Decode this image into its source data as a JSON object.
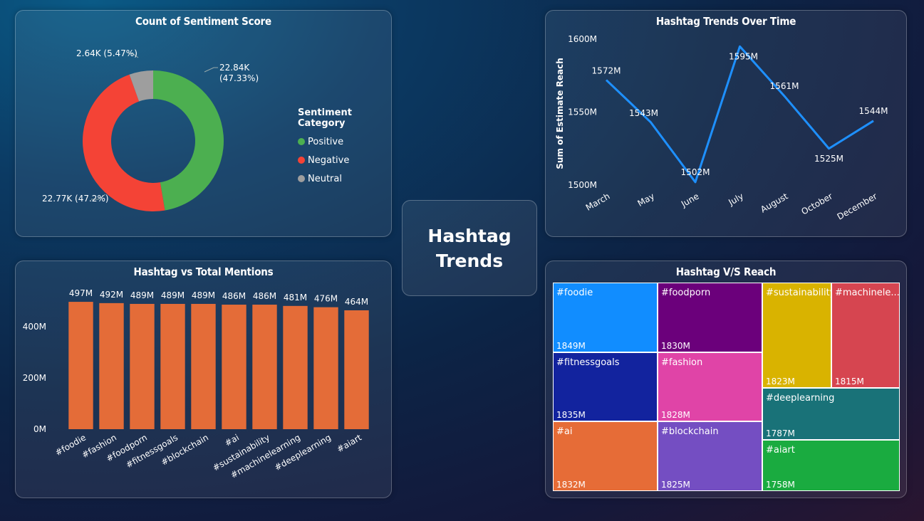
{
  "dashboard_title": "Hashtag Trends",
  "colors": {
    "positive": "#4caf50",
    "negative": "#f44336",
    "neutral": "#9e9e9e",
    "bar": "#e46c38",
    "line": "#1e90ff"
  },
  "chart_data": [
    {
      "id": "sentiment",
      "type": "pie",
      "variant": "donut",
      "title": "Count of Sentiment Score",
      "legend_title": "Sentiment Category",
      "legend_position": "right",
      "slices": [
        {
          "name": "Positive",
          "value": 22840,
          "label": "22.84K",
          "percent": "(47.33%)"
        },
        {
          "name": "Negative",
          "value": 22770,
          "label": "22.77K (47.2%)"
        },
        {
          "name": "Neutral",
          "value": 2640,
          "label": "2.64K (5.47%)"
        }
      ]
    },
    {
      "id": "trend",
      "type": "line",
      "title": "Hashtag Trends Over Time",
      "xlabel": "",
      "ylabel": "Sum of Estimate Reach",
      "categories": [
        "March",
        "May",
        "June",
        "July",
        "August",
        "October",
        "December"
      ],
      "values": [
        1572,
        1543,
        1502,
        1595,
        1561,
        1525,
        1544
      ],
      "value_labels": [
        "1572M",
        "1543M",
        "1502M",
        "1595M",
        "1561M",
        "1525M",
        "1544M"
      ],
      "ylim": [
        1500,
        1600
      ],
      "yticks": [
        1500,
        1550,
        1600
      ],
      "ytick_labels": [
        "1500M",
        "1550M",
        "1600M"
      ],
      "grid": false
    },
    {
      "id": "mentions",
      "type": "bar",
      "title": "Hashtag vs Total Mentions",
      "xlabel": "",
      "ylabel": "",
      "categories": [
        "#foodie",
        "#fashion",
        "#foodporn",
        "#fitnessgoals",
        "#blockchain",
        "#ai",
        "#sustainability",
        "#machinelearning",
        "#deeplearning",
        "#aiart"
      ],
      "values": [
        497,
        492,
        489,
        489,
        489,
        486,
        486,
        481,
        476,
        464
      ],
      "value_labels": [
        "497M",
        "492M",
        "489M",
        "489M",
        "489M",
        "486M",
        "486M",
        "481M",
        "476M",
        "464M"
      ],
      "ylim": [
        0,
        500
      ],
      "yticks": [
        0,
        200,
        400
      ],
      "ytick_labels": [
        "0M",
        "200M",
        "400M"
      ],
      "grid": false
    },
    {
      "id": "reach",
      "type": "treemap",
      "title": "Hashtag V/S Reach",
      "items": [
        {
          "label": "#foodie",
          "value_label": "1849M",
          "value": 1849,
          "color": "#118dff"
        },
        {
          "label": "#fitnessgoals",
          "value_label": "1835M",
          "value": 1835,
          "color": "#12239e"
        },
        {
          "label": "#ai",
          "value_label": "1832M",
          "value": 1832,
          "color": "#e66c37"
        },
        {
          "label": "#foodporn",
          "value_label": "1830M",
          "value": 1830,
          "color": "#6b007b"
        },
        {
          "label": "#fashion",
          "value_label": "1828M",
          "value": 1828,
          "color": "#e044a7"
        },
        {
          "label": "#blockchain",
          "value_label": "1825M",
          "value": 1825,
          "color": "#744ec2"
        },
        {
          "label": "#sustainability",
          "value_label": "1823M",
          "value": 1823,
          "color": "#d9b300"
        },
        {
          "label": "#machinele...",
          "value_label": "1815M",
          "value": 1815,
          "color": "#d64550"
        },
        {
          "label": "#deeplearning",
          "value_label": "1787M",
          "value": 1787,
          "color": "#197278"
        },
        {
          "label": "#aiart",
          "value_label": "1758M",
          "value": 1758,
          "color": "#1aab40"
        }
      ]
    }
  ]
}
